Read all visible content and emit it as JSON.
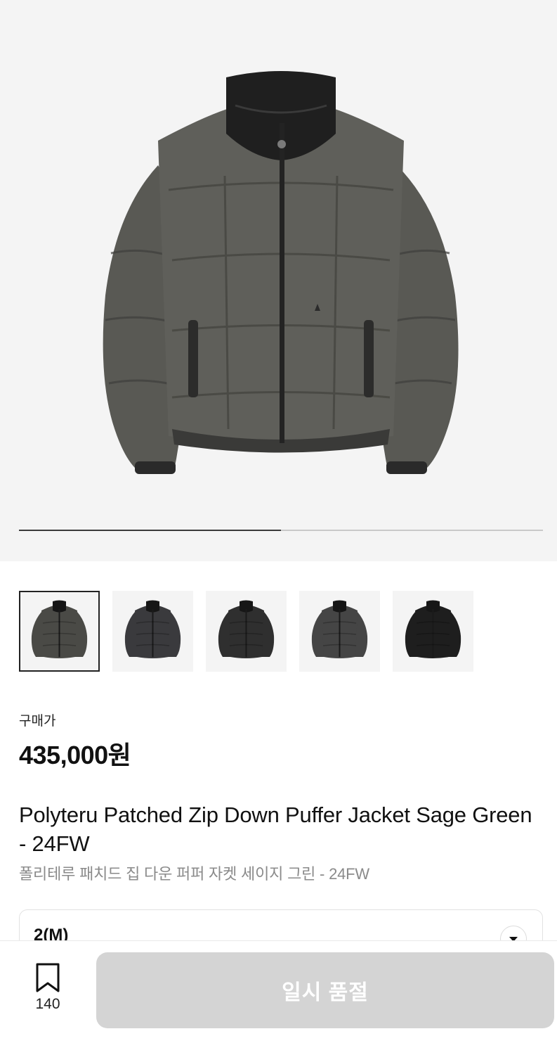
{
  "gallery": {
    "progress": 0.5,
    "thumbnails": [
      {
        "color": "#4a4a46",
        "selected": true
      },
      {
        "color": "#3a3a3d",
        "selected": false
      },
      {
        "color": "#2f2f2f",
        "selected": false
      },
      {
        "color": "#454545",
        "selected": false
      },
      {
        "color": "#1e1e1e",
        "selected": false
      }
    ]
  },
  "price": {
    "label": "구매가",
    "value": "435,000원"
  },
  "product": {
    "title": "Polyteru Patched Zip Down Puffer Jacket Sage Green - 24FW",
    "subtitle": "폴리테루 패치드 집 다운 퍼퍼 자켓 세이지 그린 - 24FW"
  },
  "size_selector": {
    "value": "2(M)"
  },
  "bottom_bar": {
    "bookmark_count": "140",
    "button_label": "일시 품절"
  },
  "colors": {
    "jacket_main": "#5a5a55",
    "collar": "#1f1f1f",
    "button_disabled": "#d4d4d4"
  }
}
